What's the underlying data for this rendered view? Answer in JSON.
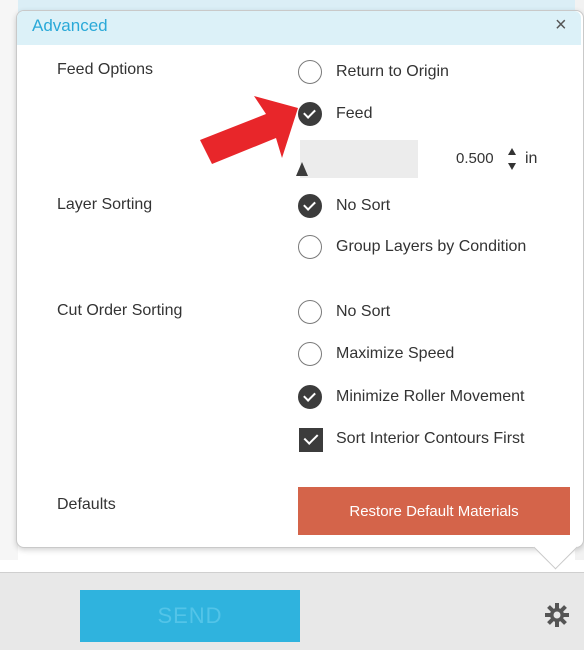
{
  "window": {
    "title": "Advanced",
    "close_label": "×"
  },
  "feed_options": {
    "label": "Feed Options",
    "return_to_origin": {
      "label": "Return to Origin",
      "selected": false
    },
    "feed": {
      "label": "Feed",
      "selected": true
    },
    "feed_amount": {
      "value": "0.500",
      "unit": "in"
    }
  },
  "layer_sorting": {
    "label": "Layer Sorting",
    "options": [
      {
        "label": "No Sort",
        "selected": true
      },
      {
        "label": "Group Layers by Condition",
        "selected": false
      }
    ]
  },
  "cut_order_sorting": {
    "label": "Cut Order Sorting",
    "options": [
      {
        "label": "No Sort",
        "selected": false
      },
      {
        "label": "Maximize Speed",
        "selected": false
      },
      {
        "label": "Minimize Roller Movement",
        "selected": true
      }
    ],
    "sort_interior": {
      "label": "Sort Interior Contours First",
      "checked": true
    }
  },
  "defaults": {
    "label": "Defaults",
    "restore_button": "Restore Default Materials"
  },
  "bottom_bar": {
    "send_label": "SEND"
  },
  "icons": {
    "close": "close-icon",
    "gear": "gear-icon",
    "arrow": "red-arrow-icon",
    "spinner": "up-down-spinner-icon"
  },
  "colors": {
    "accent": "#2aa9d8",
    "header_bg": "#dcf1f8",
    "restore": "#d4644a",
    "send": "#2fb3de",
    "arrow": "#e8262a"
  }
}
